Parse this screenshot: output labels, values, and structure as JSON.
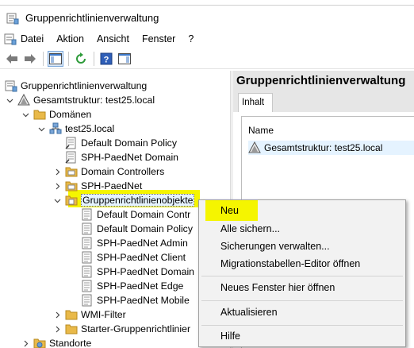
{
  "window": {
    "title": "Gruppenrichtlinienverwaltung"
  },
  "menu": [
    "Datei",
    "Aktion",
    "Ansicht",
    "Fenster",
    "?"
  ],
  "tree": {
    "root": "Gruppenrichtlinienverwaltung",
    "forest": "Gesamtstruktur: test25.local",
    "domains": "Domänen",
    "domain": "test25.local",
    "default_domain_policy": "Default Domain Policy",
    "sph_paednet_domain": "SPH-PaedNet Domain",
    "domain_controllers": "Domain Controllers",
    "sph_paednet": "SPH-PaedNet",
    "gpo_container": "Gruppenrichtlinienobjekte",
    "gpo_items": [
      "Default Domain Contr",
      "Default Domain Policy",
      "SPH-PaedNet Admin",
      "SPH-PaedNet Client",
      "SPH-PaedNet Domain",
      "SPH-PaedNet Edge",
      "SPH-PaedNet Mobile"
    ],
    "wmi_filter": "WMI-Filter",
    "starter_gpo": "Starter-Gruppenrichtlinier",
    "sites": "Standorte"
  },
  "right_pane": {
    "title": "Gruppenrichtlinienverwaltung",
    "tab": "Inhalt",
    "column": "Name",
    "item": "Gesamtstruktur: test25.local"
  },
  "context_menu": {
    "new": "Neu",
    "backup_all": "Alle sichern...",
    "manage_backups": "Sicherungen verwalten...",
    "migration_editor": "Migrationstabellen-Editor öffnen",
    "new_window": "Neues Fenster hier öffnen",
    "refresh": "Aktualisieren",
    "help": "Hilfe"
  },
  "highlight_color": "#f5f500"
}
